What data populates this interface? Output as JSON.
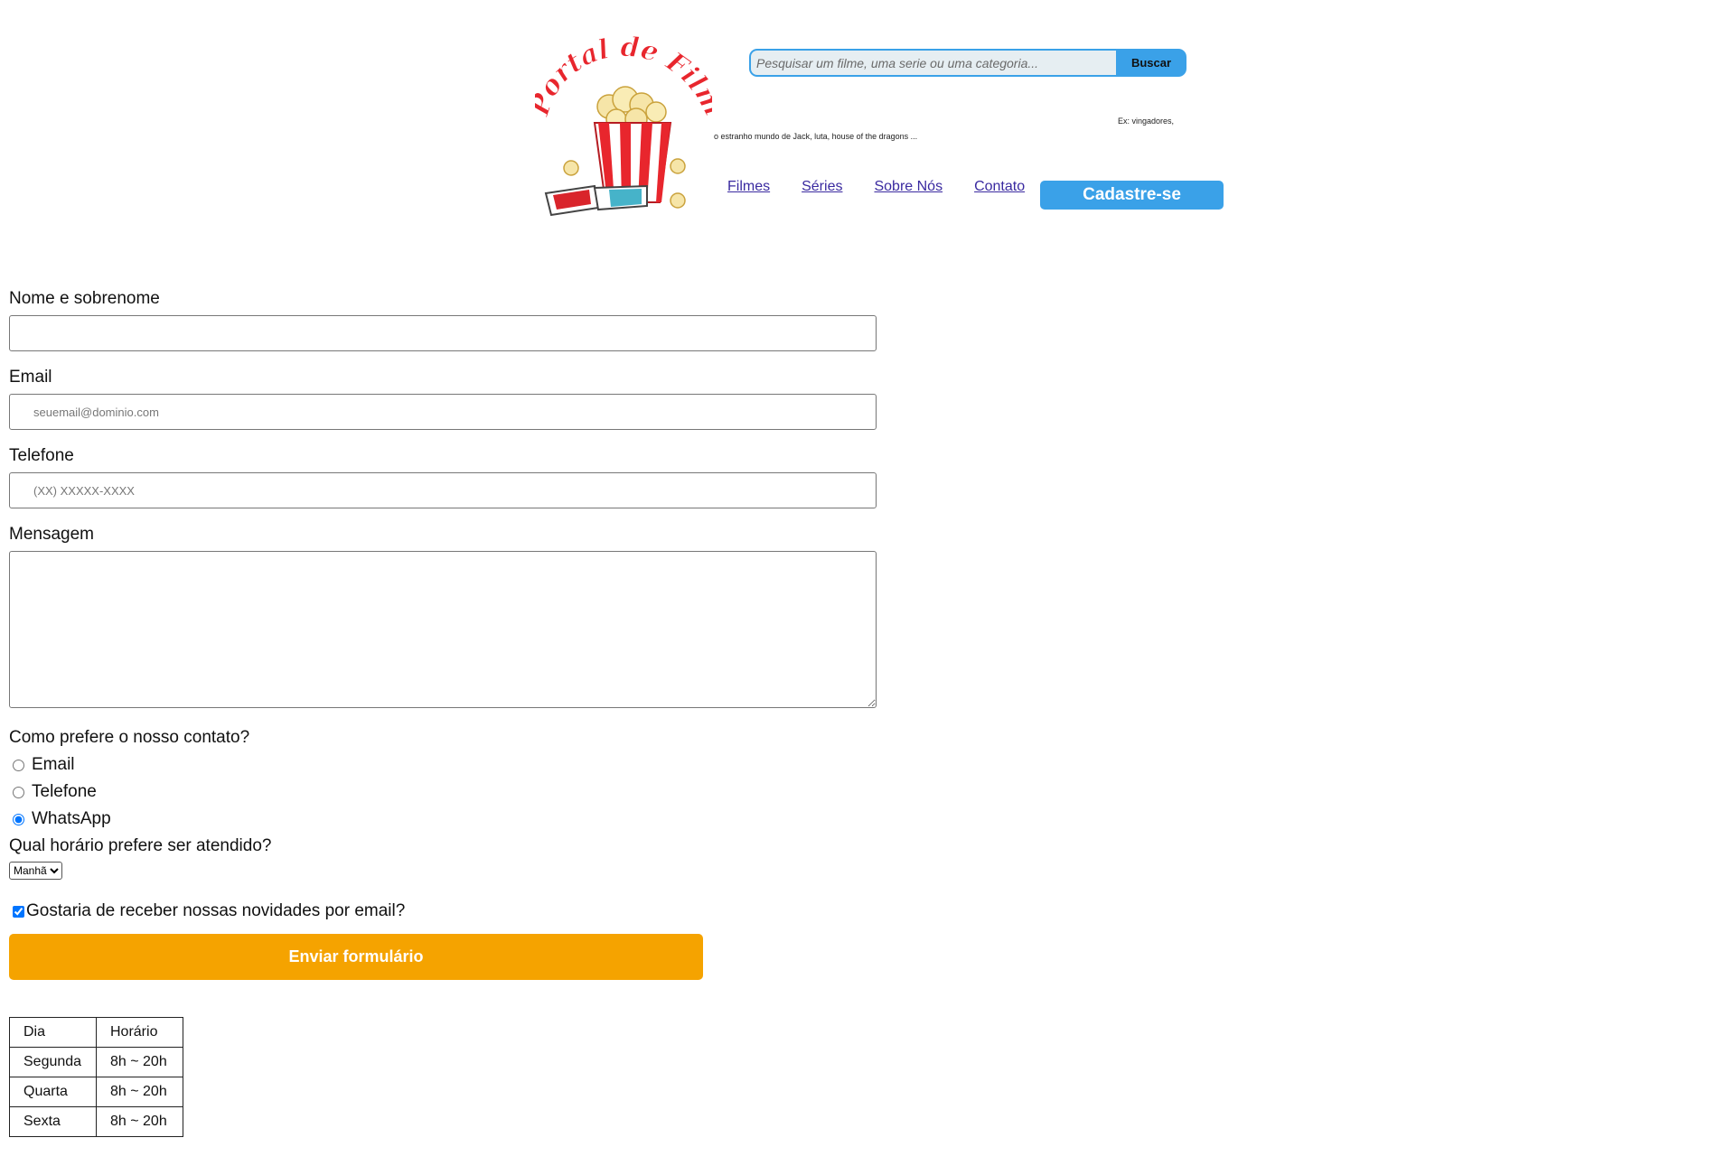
{
  "header": {
    "logo_text": "Portal de Filmes",
    "search": {
      "placeholder": "Pesquisar um filme, uma serie ou uma categoria...",
      "button_label": "Buscar",
      "hint_line1": "Ex:  vingadores,",
      "hint_line2": "o estranho mundo de Jack,  luta,  house of the dragons ..."
    },
    "nav": {
      "items": [
        "Filmes",
        "Séries",
        "Sobre Nós",
        "Contato"
      ],
      "cta_label": "Cadastre-se"
    }
  },
  "form": {
    "name_label": "Nome e sobrenome",
    "email_label": "Email",
    "email_placeholder": "seuemail@dominio.com",
    "phone_label": "Telefone",
    "phone_placeholder": "(XX) XXXXX-XXXX",
    "message_label": "Mensagem",
    "contact_question": "Como prefere o nosso contato?",
    "contact_options": [
      "Email",
      "Telefone",
      "WhatsApp"
    ],
    "contact_selected": "WhatsApp",
    "time_question": "Qual horário prefere ser atendido?",
    "time_selected": "Manhã",
    "newsletter_label": "Gostaria de receber nossas novidades por email?",
    "newsletter_checked": true,
    "submit_label": "Enviar formulário"
  },
  "schedule": {
    "headers": [
      "Dia",
      "Horário"
    ],
    "rows": [
      [
        "Segunda",
        "8h ~ 20h"
      ],
      [
        "Quarta",
        "8h ~ 20h"
      ],
      [
        "Sexta",
        "8h ~ 20h"
      ]
    ]
  },
  "colors": {
    "accent_blue": "#3aa1e8",
    "submit_orange": "#f5a300",
    "logo_red": "#e8262d"
  }
}
